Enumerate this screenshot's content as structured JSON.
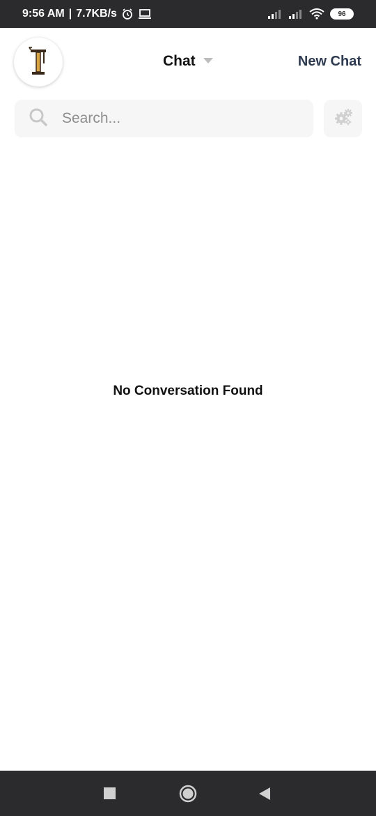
{
  "status_bar": {
    "time": "9:56 AM",
    "speed": "7.7KB/s",
    "battery": "96",
    "icons": [
      "alarm-icon",
      "laptop-icon",
      "signal-icon",
      "signal-icon",
      "wifi-icon",
      "battery-icon"
    ]
  },
  "header": {
    "title": "Chat",
    "dropdown_icon": "caret-down-icon",
    "new_chat_label": "New Chat",
    "avatar_icon": "logo-icon"
  },
  "search": {
    "placeholder": "Search...",
    "value": "",
    "icon": "search-icon",
    "settings_icon": "gear-icon"
  },
  "main": {
    "empty_message": "No Conversation Found"
  },
  "nav_bar": {
    "icons": [
      "recent-apps-icon",
      "home-icon",
      "back-icon"
    ]
  },
  "colors": {
    "status_bar_bg": "#2b2b2d",
    "search_bg": "#f6f6f6",
    "new_chat_text": "#2d3a4f"
  }
}
